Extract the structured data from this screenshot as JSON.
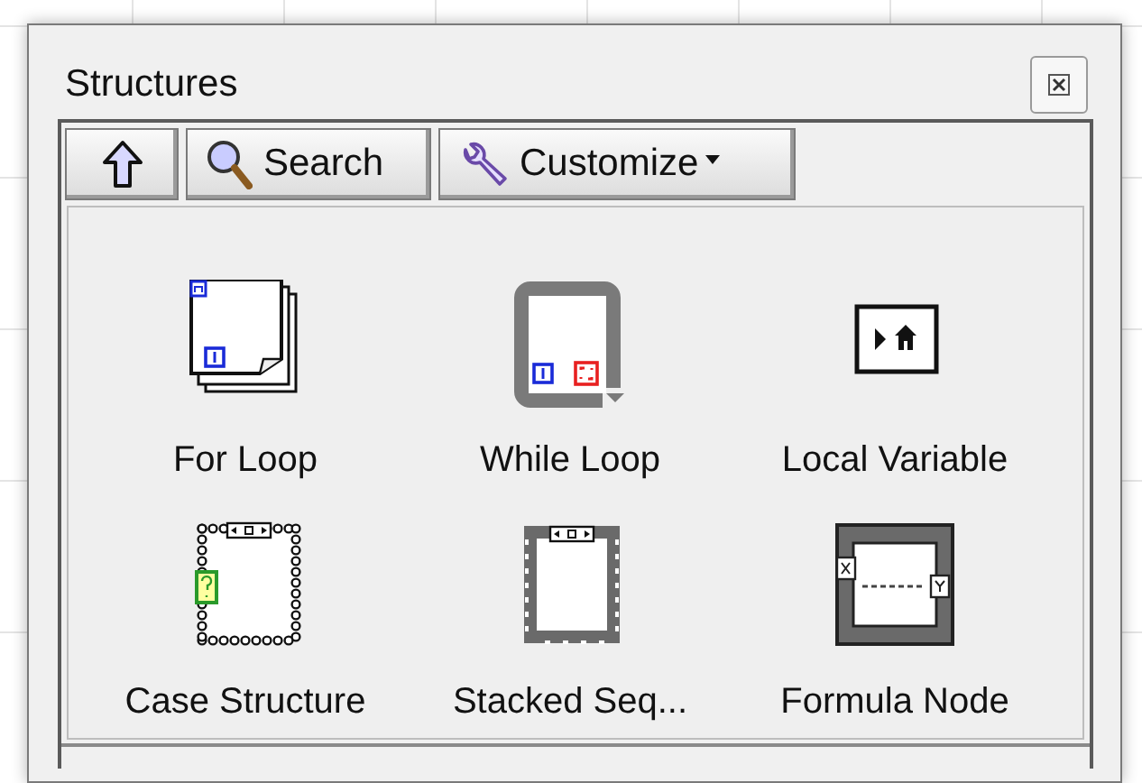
{
  "window": {
    "title": "Structures"
  },
  "toolbar": [
    {
      "kind": "up"
    },
    {
      "kind": "search",
      "label": "Search"
    },
    {
      "kind": "customize",
      "label": "Customize"
    }
  ],
  "items": [
    {
      "kind": "for_loop",
      "label": "For Loop"
    },
    {
      "kind": "while_loop",
      "label": "While Loop"
    },
    {
      "kind": "local_variable",
      "label": "Local Variable"
    },
    {
      "kind": "case_structure",
      "label": "Case Structure"
    },
    {
      "kind": "stacked_sequence",
      "label": "Stacked Seq..."
    },
    {
      "kind": "formula_node",
      "label": "Formula Node"
    }
  ]
}
